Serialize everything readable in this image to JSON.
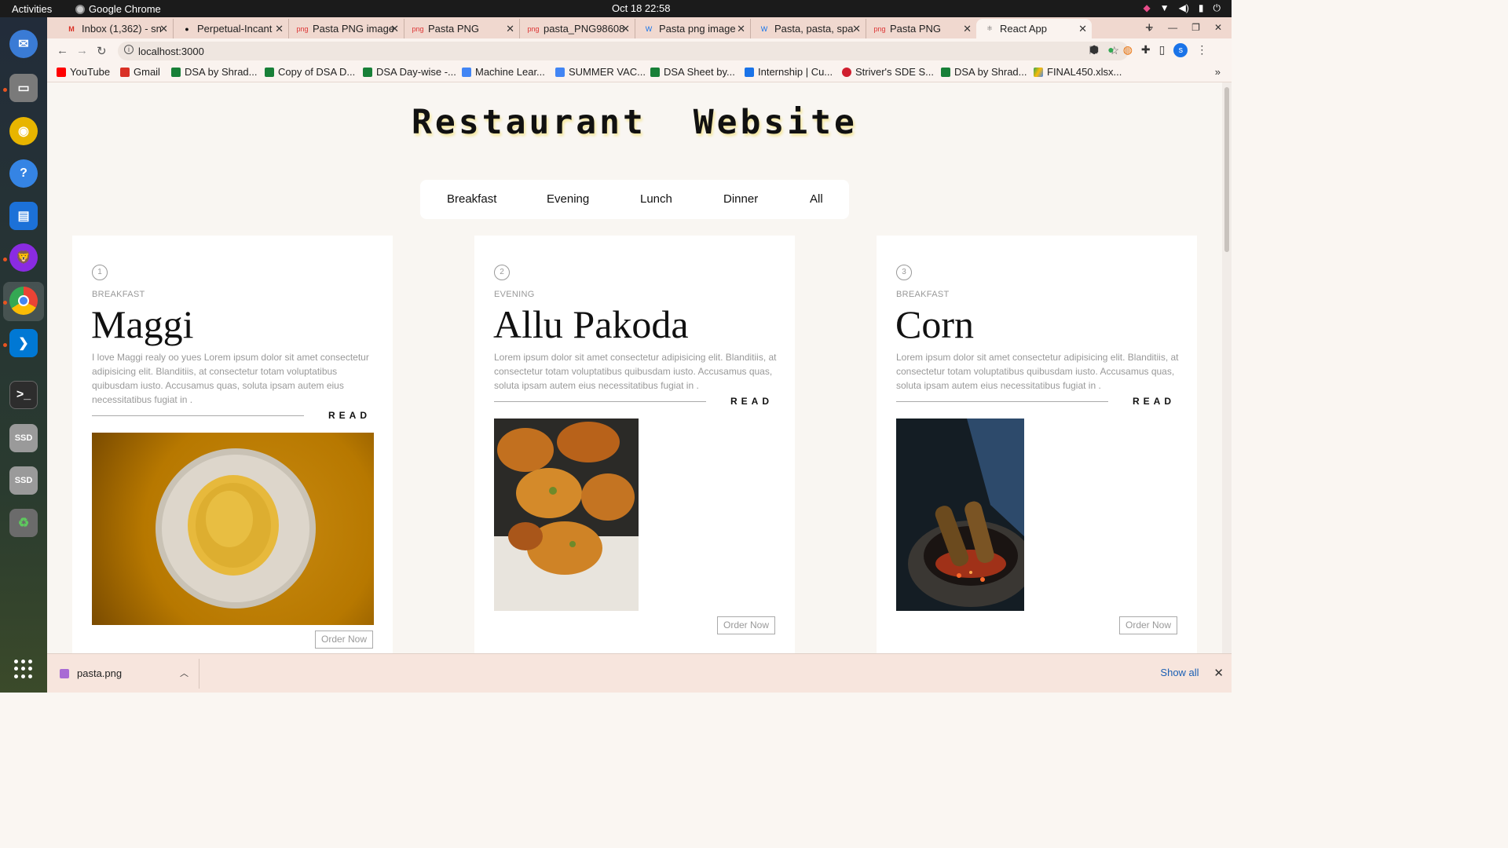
{
  "system": {
    "activities": "Activities",
    "app_name": "Google Chrome",
    "clock": "Oct 18  22:58"
  },
  "tabs": [
    {
      "label": "Inbox (1,362) - sn",
      "icon": "gmail-icon"
    },
    {
      "label": "Perpetual-Incant",
      "icon": "github-icon"
    },
    {
      "label": "Pasta PNG image",
      "icon": "png-icon"
    },
    {
      "label": "Pasta PNG",
      "icon": "png-icon"
    },
    {
      "label": "pasta_PNG98608",
      "icon": "png-icon"
    },
    {
      "label": "Pasta png image",
      "icon": "freepik-icon"
    },
    {
      "label": "Pasta, pasta, spa",
      "icon": "freepik-icon"
    },
    {
      "label": "Pasta PNG",
      "icon": "png-icon"
    },
    {
      "label": "React App",
      "icon": "react-icon",
      "active": true
    }
  ],
  "toolbar": {
    "url": "localhost:3000"
  },
  "bookmarks": [
    {
      "label": "YouTube",
      "color": "#ff0000"
    },
    {
      "label": "Gmail",
      "color": "#d93025"
    },
    {
      "label": "DSA by Shrad...",
      "color": "#188038"
    },
    {
      "label": "Copy of DSA D...",
      "color": "#188038"
    },
    {
      "label": "DSA Day-wise -...",
      "color": "#188038"
    },
    {
      "label": "Machine Lear...",
      "color": "#4285f4"
    },
    {
      "label": "SUMMER VAC...",
      "color": "#4285f4"
    },
    {
      "label": "DSA Sheet by...",
      "color": "#188038"
    },
    {
      "label": "Internship | Cu...",
      "color": "#1a73e8"
    },
    {
      "label": "Striver's SDE S...",
      "color": "#d01e2e"
    },
    {
      "label": "DSA by Shrad...",
      "color": "#188038"
    },
    {
      "label": "FINAL450.xlsx...",
      "color": "#f4b400"
    }
  ],
  "page": {
    "title": "Restaurant  Website",
    "filters": [
      "Breakfast",
      "Evening",
      "Lunch",
      "Dinner",
      "All"
    ],
    "read_label": "READ",
    "order_label": "Order Now",
    "cards": [
      {
        "num": "1",
        "category": "BREAKFAST",
        "name": "Maggi",
        "description": "I love Maggi realy oo yues Lorem ipsum dolor sit amet consectetur adipisicing elit. Blanditiis, at consectetur totam voluptatibus quibusdam iusto. Accusamus quas, soluta ipsam autem eius necessitatibus fugiat in ."
      },
      {
        "num": "2",
        "category": "EVENING",
        "name": "Allu Pakoda",
        "description": "Lorem ipsum dolor sit amet consectetur adipisicing elit. Blanditiis, at consectetur totam voluptatibus quibusdam iusto. Accusamus quas, soluta ipsam autem eius necessitatibus fugiat in ."
      },
      {
        "num": "3",
        "category": "BREAKFAST",
        "name": "Corn",
        "description": "Lorem ipsum dolor sit amet consectetur adipisicing elit. Blanditiis, at consectetur totam voluptatibus quibusdam iusto. Accusamus quas, soluta ipsam autem eius necessitatibus fugiat in ."
      }
    ]
  },
  "download": {
    "filename": "pasta.png",
    "show_all": "Show all"
  }
}
